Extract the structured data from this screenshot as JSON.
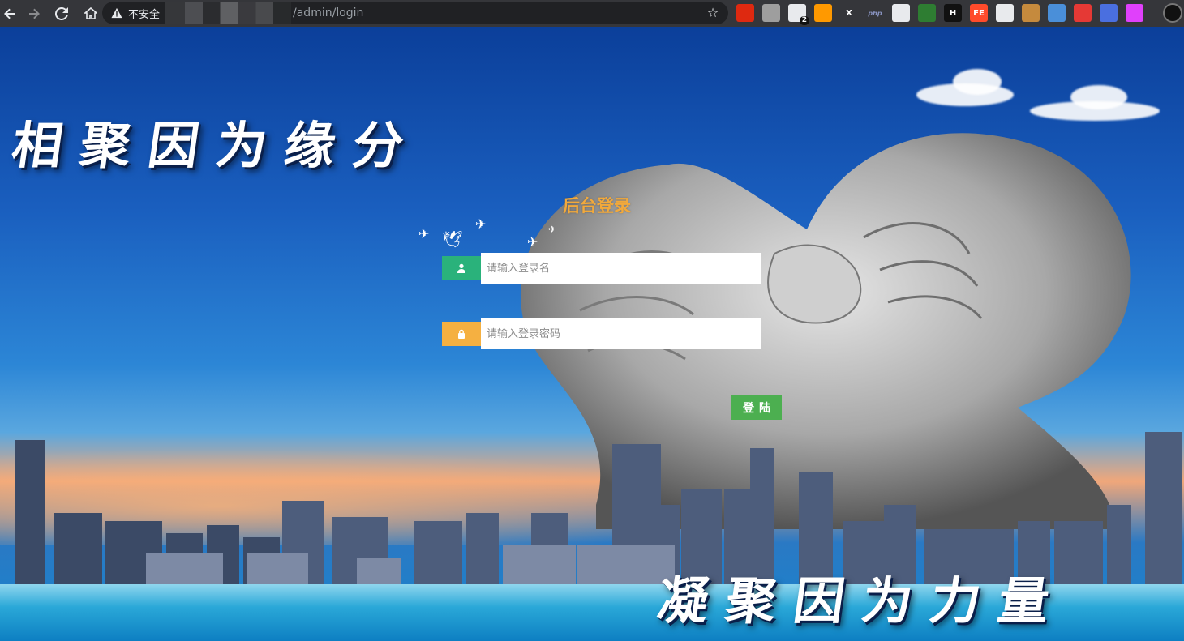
{
  "browser": {
    "security_label": "不安全",
    "url_path": "/admin/login",
    "extensions": [
      {
        "name": "china-flag-ext",
        "color": "#de2910",
        "text": ""
      },
      {
        "name": "circle-ext",
        "color": "#9e9e9e",
        "text": ""
      },
      {
        "name": "tampermonkey-ext",
        "color": "#e8eaed",
        "text": "",
        "badge": "2"
      },
      {
        "name": "amazon-ext",
        "color": "#ff9900",
        "text": ""
      },
      {
        "name": "x-ext",
        "color": "#35363a",
        "text": "X"
      },
      {
        "name": "php-ext",
        "color": "#35363a",
        "text": "php"
      },
      {
        "name": "ninja-ext",
        "color": "#e8eaed",
        "text": ""
      },
      {
        "name": "green-gear-ext",
        "color": "#2e7d32",
        "text": ""
      },
      {
        "name": "h-ext",
        "color": "#111111",
        "text": "H"
      },
      {
        "name": "fe-ext",
        "color": "#ff4b2b",
        "text": "FE"
      },
      {
        "name": "ghost-ext",
        "color": "#e8eaed",
        "text": ""
      },
      {
        "name": "cookie-ext",
        "color": "#c58a3d",
        "text": ""
      },
      {
        "name": "globe-ext",
        "color": "#4a8fd9",
        "text": ""
      },
      {
        "name": "red-eye-ext",
        "color": "#e53935",
        "text": ""
      },
      {
        "name": "firefox-ext",
        "color": "#4a6fe0",
        "text": ""
      },
      {
        "name": "pinwheel-ext",
        "color": "#e040fb",
        "text": ""
      }
    ]
  },
  "page": {
    "slogan_top": "相聚因为缘分",
    "slogan_bottom": "凝聚因为力量",
    "login": {
      "title": "后台登录",
      "username_placeholder": "请输入登录名",
      "password_placeholder": "请输入登录密码",
      "submit_label": "登陆",
      "username_icon_color": "#2ab27b",
      "password_icon_color": "#f5b041"
    }
  }
}
